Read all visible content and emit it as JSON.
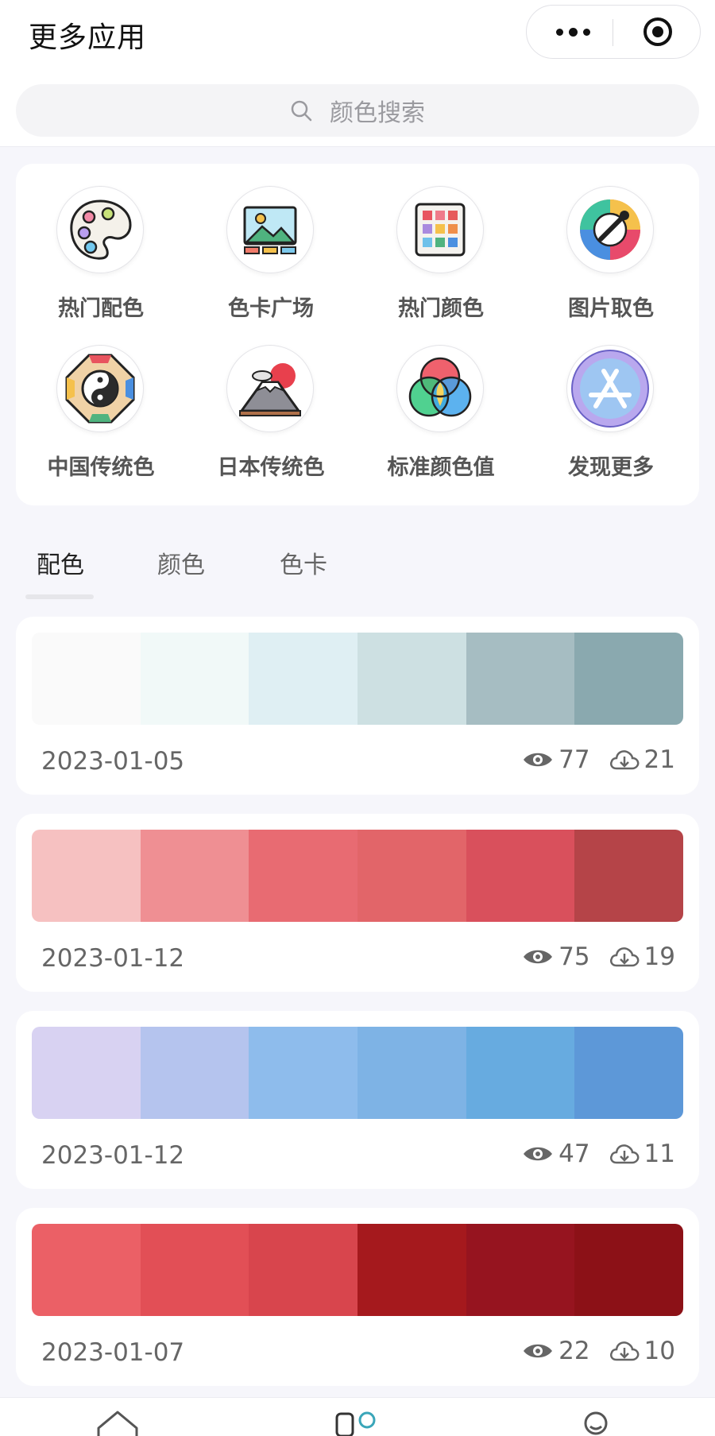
{
  "header": {
    "title": "更多应用"
  },
  "search": {
    "placeholder": "颜色搜索"
  },
  "categories": [
    {
      "label": "热门配色",
      "icon": "palette-icon"
    },
    {
      "label": "色卡广场",
      "icon": "image-gallery-icon"
    },
    {
      "label": "热门颜色",
      "icon": "color-grid-icon"
    },
    {
      "label": "图片取色",
      "icon": "eyedropper-icon"
    },
    {
      "label": "中国传统色",
      "icon": "bagua-icon"
    },
    {
      "label": "日本传统色",
      "icon": "mount-fuji-icon"
    },
    {
      "label": "标准颜色值",
      "icon": "rgb-circles-icon"
    },
    {
      "label": "发现更多",
      "icon": "app-store-icon"
    }
  ],
  "tabs": [
    {
      "label": "配色",
      "active": true
    },
    {
      "label": "颜色",
      "active": false
    },
    {
      "label": "色卡",
      "active": false
    }
  ],
  "palettes": [
    {
      "date": "2023-01-05",
      "views": "77",
      "downloads": "21",
      "colors": [
        "#fafafa",
        "#f1f9f8",
        "#dfeff3",
        "#cde0e2",
        "#a6bdc2",
        "#8aa9af"
      ]
    },
    {
      "date": "2023-01-12",
      "views": "75",
      "downloads": "19",
      "colors": [
        "#f6c1c1",
        "#ef8f93",
        "#e86b72",
        "#e26569",
        "#d9505c",
        "#b54448"
      ]
    },
    {
      "date": "2023-01-12",
      "views": "47",
      "downloads": "11",
      "colors": [
        "#d8d2f2",
        "#b5c4ee",
        "#8ebcec",
        "#7eb3e5",
        "#67abe0",
        "#5d98d8"
      ]
    },
    {
      "date": "2023-01-07",
      "views": "22",
      "downloads": "10",
      "colors": [
        "#eb6066",
        "#e24f56",
        "#d8454d",
        "#a5191d",
        "#96141f",
        "#8c1117"
      ]
    }
  ],
  "colors": {
    "background": "#f6f6fb",
    "card": "#ffffff",
    "text_muted": "#666666"
  }
}
